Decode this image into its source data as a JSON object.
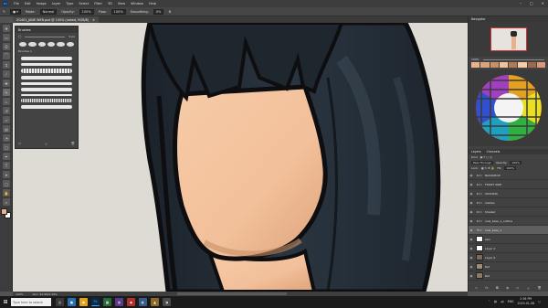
{
  "app": {
    "logo_text": "Ps",
    "menu": [
      "File",
      "Edit",
      "Image",
      "Layer",
      "Type",
      "Select",
      "Filter",
      "3D",
      "View",
      "Window",
      "Help"
    ],
    "window_controls": [
      "–",
      "□",
      "✕"
    ]
  },
  "options_bar": {
    "mode_label": "Mode:",
    "mode_value": "Normal",
    "opacity_label": "Opacity:",
    "opacity_value": "100%",
    "flow_label": "Flow:",
    "flow_value": "100%",
    "smoothing_label": "Smoothing:",
    "smoothing_value": "0%"
  },
  "document": {
    "tab_title": "ZG401_JANE WEB.psd @ 100% (naked, RGB/8)",
    "close_glyph": "✕"
  },
  "status_bar": {
    "zoom": "100%",
    "doc_size": "Doc: 94.9M/1.25G"
  },
  "brush_panel": {
    "title": "Brushes",
    "size_value": "9 px",
    "group_label": "Brushes 1"
  },
  "right_panel": {
    "navigator_tab": "Navigator",
    "navigator_zoom": "100%",
    "layers_tab": "Layers",
    "channels_tab": "Channels",
    "kind_label": "Kind",
    "blend_mode": "Pass Through",
    "opacity_label": "Opacity:",
    "opacity_value": "100%",
    "lock_label": "Lock:",
    "fill_label": "Fill:",
    "fill_value": "100%",
    "layers": [
      {
        "name": "BACKDROP",
        "kind": "folder"
      },
      {
        "name": "FRONT SIDE",
        "kind": "folder"
      },
      {
        "name": "SHADING",
        "kind": "folder"
      },
      {
        "name": "shades",
        "kind": "folder"
      },
      {
        "name": "Shaded",
        "kind": "folder"
      },
      {
        "name": "new_base_1_outline",
        "kind": "folder"
      },
      {
        "name": "new_base_1",
        "kind": "folder"
      },
      {
        "name": "skin",
        "kind": "layer"
      },
      {
        "name": "Layer 2",
        "kind": "layer"
      },
      {
        "name": "Layer 6",
        "kind": "layer"
      },
      {
        "name": "Ref",
        "kind": "layer"
      },
      {
        "name": "Ref",
        "kind": "layer"
      }
    ],
    "selected_layer": "new_base_1"
  },
  "taskbar": {
    "start_glyph": "⊞",
    "search_placeholder": "Type here to search",
    "apps": [
      "◎",
      "▣",
      "◉",
      "Ps",
      "▦",
      "◍",
      "◆",
      "◐",
      "▲",
      "◑"
    ],
    "tray_lang": "ENG",
    "time": "2:36 PM",
    "date": "2019-01-08"
  },
  "colors": {
    "skin": "#f2c09a",
    "skin_shadow": "#dea37b",
    "hair": "#222b34",
    "hair_highlight": "#4a5a68",
    "outline": "#0e0e10",
    "canvas_bg": "#dedbd5",
    "accent_blue": "#31a8ff"
  }
}
